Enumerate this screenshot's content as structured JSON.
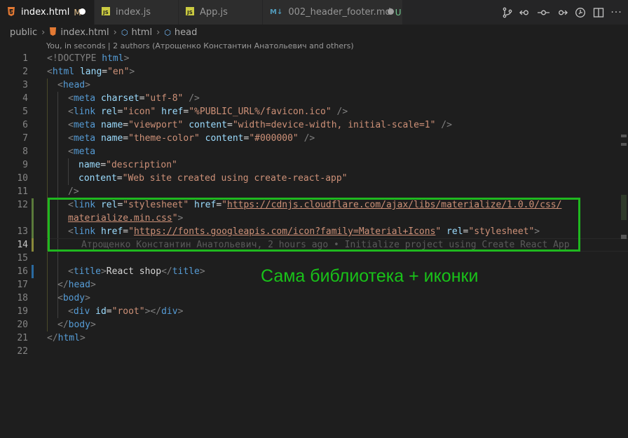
{
  "tabs": [
    {
      "icon": "5",
      "label": "index.html",
      "badge": "M",
      "color": "#e37933",
      "active": true,
      "dot": "#ffffff"
    },
    {
      "icon": "JS",
      "label": "index.js",
      "badge": "",
      "color": "#cbcb41",
      "active": false,
      "dot": ""
    },
    {
      "icon": "JS",
      "label": "App.js",
      "badge": "",
      "color": "#cbcb41",
      "active": false,
      "dot": ""
    },
    {
      "icon": "M↓",
      "label": "002_header_footer.md",
      "badge": "U",
      "color": "#519aba",
      "active": false,
      "dot": "#9e9e9e"
    }
  ],
  "breadcrumb": {
    "folder": "public",
    "file": "index.html",
    "el1": "html",
    "el2": "head"
  },
  "blame_header": "You, in seconds | 2 authors (Атрощенко Константин Анатольевич and others)",
  "line_numbers": [
    "1",
    "2",
    "3",
    "4",
    "5",
    "6",
    "7",
    "8",
    "9",
    "10",
    "11",
    "12",
    "",
    "13",
    "14",
    "15",
    "16",
    "17",
    "18",
    "19",
    "20",
    "21",
    "22"
  ],
  "code": {
    "l1_doctype": "<!DOCTYPE ",
    "l1_html": "html",
    "l1_end": ">",
    "l2": [
      "<",
      "html",
      " lang",
      "=",
      "\"en\"",
      ">"
    ],
    "l3": [
      "<",
      "head",
      ">"
    ],
    "l4": [
      "<",
      "meta",
      " charset",
      "=",
      "\"utf-8\"",
      " />"
    ],
    "l5": [
      "<",
      "link",
      " rel",
      "=",
      "\"icon\"",
      " href",
      "=",
      "\"%PUBLIC_URL%/favicon.ico\"",
      " />"
    ],
    "l6": [
      "<",
      "meta",
      " name",
      "=",
      "\"viewport\"",
      " content",
      "=",
      "\"width=device-width, initial-scale=1\"",
      " />"
    ],
    "l7": [
      "<",
      "meta",
      " name",
      "=",
      "\"theme-color\"",
      " content",
      "=",
      "\"#000000\"",
      " />"
    ],
    "l8": [
      "<",
      "meta"
    ],
    "l9": [
      "name",
      "=",
      "\"description\""
    ],
    "l10": [
      "content",
      "=",
      "\"Web site created using create-react-app\""
    ],
    "l11": [
      "/>"
    ],
    "l12a": [
      "<",
      "link",
      " rel",
      "=",
      "\"stylesheet\"",
      " href",
      "=",
      "\"",
      "https://cdnjs.cloudflare.com/ajax/libs/materialize/1.0.0/css/"
    ],
    "l12b": [
      "materialize.min.css",
      "\"",
      ">"
    ],
    "l13": [
      "<",
      "link",
      " href",
      "=",
      "\"",
      "https://fonts.googleapis.com/icon?family=Material+Icons",
      "\"",
      " rel",
      "=",
      "\"stylesheet\"",
      ">"
    ],
    "l14_ghost": "Атрощенко Константин Анатольевич, 2 hours ago • Initialize project using Create React App",
    "l16": [
      "<",
      "title",
      ">",
      "React shop",
      "</",
      "title",
      ">"
    ],
    "l17": [
      "</",
      "head",
      ">"
    ],
    "l18": [
      "<",
      "body",
      ">"
    ],
    "l19": [
      "<",
      "div",
      " id",
      "=",
      "\"root\"",
      "></",
      "div",
      ">"
    ],
    "l20": [
      "</",
      "body",
      ">"
    ],
    "l21": [
      "</",
      "html",
      ">"
    ]
  },
  "annotation": "Сама библиотека + иконки",
  "colors": {
    "highlight_box": "#1fb81f",
    "annotation": "#19c219"
  },
  "toolbar_icons": [
    "source-control-icon",
    "go-back-icon",
    "commit-icon",
    "go-forward-icon",
    "timeline-icon",
    "split-editor-icon",
    "more-icon"
  ]
}
